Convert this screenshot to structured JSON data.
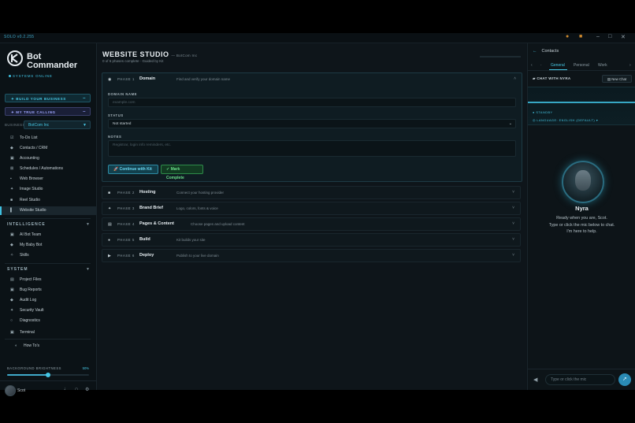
{
  "app": {
    "version": "SOLO v0.2.255"
  },
  "sidebar": {
    "logo_line1": "Bot",
    "logo_line2": "Commander",
    "logo_status": "SYSTEMS ONLINE",
    "build_label": "BUILD YOUR BUSINESS",
    "calling_label": "MY TRUE CALLING",
    "business_label": "BUSINESS:",
    "business_value": "BotCom Inc",
    "items": [
      {
        "label": "To-Do List",
        "icon": "checkbox-icon"
      },
      {
        "label": "Contacts / CRM",
        "icon": "contacts-icon"
      },
      {
        "label": "Accounting",
        "icon": "accounting-icon"
      },
      {
        "label": "Schedules / Automations",
        "icon": "schedule-icon"
      },
      {
        "label": "Web Browser",
        "icon": "browser-icon"
      },
      {
        "label": "Image Studio",
        "icon": "image-icon"
      },
      {
        "label": "Reel Studio",
        "icon": "reel-icon"
      },
      {
        "label": "Website Studio",
        "icon": "website-icon"
      }
    ],
    "intelligence_title": "INTELLIGENCE",
    "intelligence_items": [
      {
        "label": "AI Bot Team"
      },
      {
        "label": "My Baby Bot"
      },
      {
        "label": "Skills"
      }
    ],
    "system_title": "SYSTEM",
    "system_items": [
      {
        "label": "Project Files"
      },
      {
        "label": "Bug Reports"
      },
      {
        "label": "Audit Log"
      },
      {
        "label": "Security Vault"
      },
      {
        "label": "Diagnostics"
      },
      {
        "label": "Terminal"
      }
    ],
    "howtos": "How To's",
    "brightness_label": "BACKGROUND BRIGHTNESS",
    "brightness_value": "50%",
    "brightness_fraction": 0.5,
    "user_name": "Scot"
  },
  "main": {
    "title": "WEBSITE STUDIO",
    "company": "— BotCom Inc",
    "subtitle": "0 of 6 phases complete · Guided by Kit",
    "phases": [
      {
        "num": "PHASE 1",
        "name": "Domain",
        "desc": "Find and verify your domain name"
      },
      {
        "num": "PHASE 2",
        "name": "Hosting",
        "desc": "Connect your hosting provider"
      },
      {
        "num": "PHASE 3",
        "name": "Brand Brief",
        "desc": "Logo, colors, fonts & voice"
      },
      {
        "num": "PHASE 4",
        "name": "Pages & Content",
        "desc": "Choose pages and upload content"
      },
      {
        "num": "PHASE 5",
        "name": "Build",
        "desc": "Kit builds your site"
      },
      {
        "num": "PHASE 6",
        "name": "Deploy",
        "desc": "Publish to your live domain"
      }
    ],
    "domain_label": "DOMAIN NAME",
    "domain_placeholder": "example.com",
    "status_label": "STATUS",
    "status_value": "Not started",
    "notes_label": "NOTES",
    "notes_placeholder": "Registrar, login info reminders, etc.",
    "continue_btn": "Continue with Kit",
    "complete_btn": "✓ Mark Complete"
  },
  "right": {
    "title": "Contacts",
    "tabs": [
      "General",
      "Personal",
      "Work"
    ],
    "chat_header": "CHAT WITH NYRA",
    "new_chat": "New Chat",
    "status_line": "STANDBY",
    "language_label": "LANGUAGE:",
    "language_value": "ENGLISH (DEFAULT)",
    "bot_name": "Nyra",
    "bot_msg_1": "Ready when you are, Scot.",
    "bot_msg_2": "Type or click the mic below to chat.",
    "bot_msg_3": "I'm here to help.",
    "input_placeholder": "Type or click the mic"
  }
}
